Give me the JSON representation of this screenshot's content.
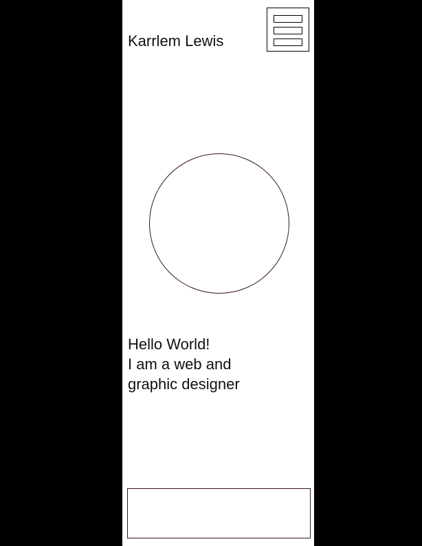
{
  "header": {
    "site_name": "Karrlem Lewis",
    "menu_icon": "hamburger-menu-icon"
  },
  "hero": {
    "avatar": "avatar-placeholder-circle"
  },
  "intro": {
    "line1": "Hello World!",
    "line2": "I am a web and",
    "line3": "graphic designer"
  },
  "colors": {
    "background": "#000000",
    "column": "#ffffff",
    "outline": "#3a1414",
    "text": "#111111"
  }
}
